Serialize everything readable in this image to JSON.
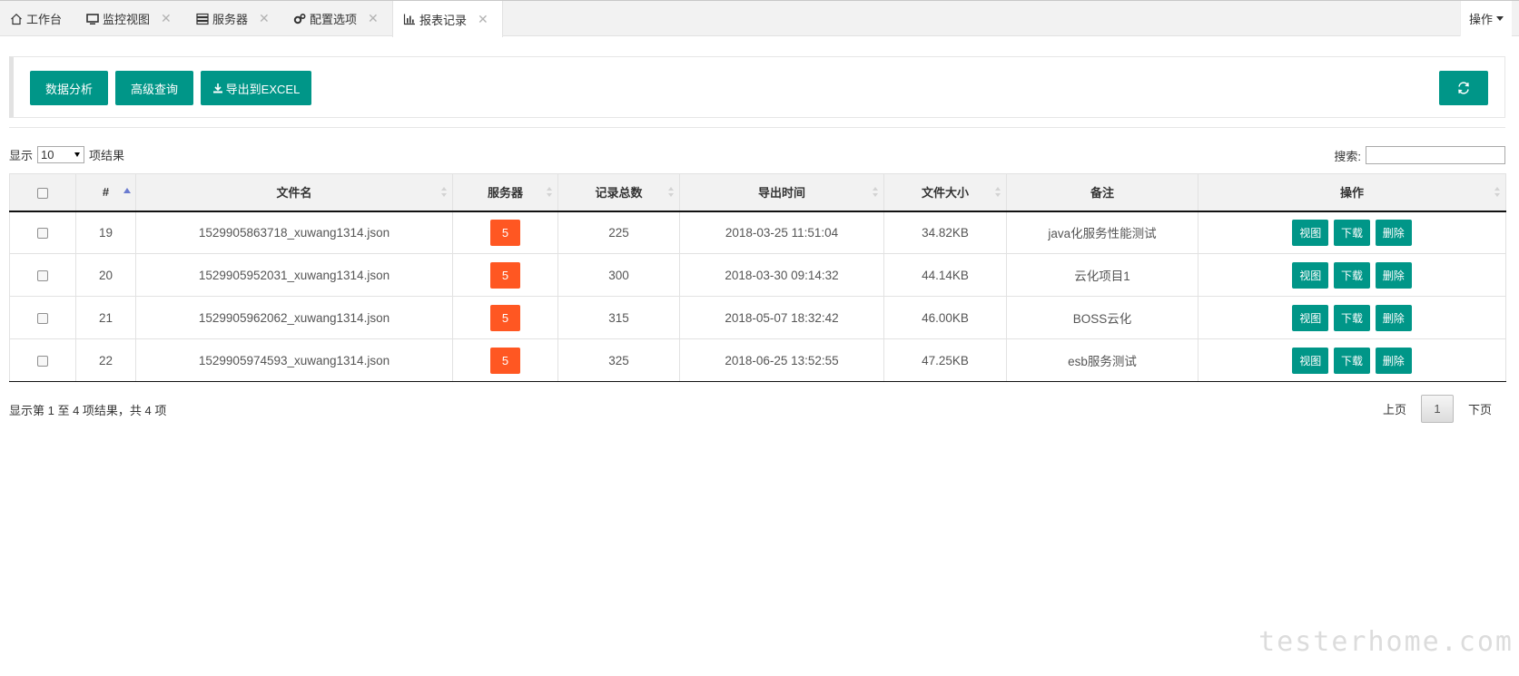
{
  "tabs": [
    {
      "label": "工作台",
      "icon": "home-icon",
      "closable": false,
      "active": false
    },
    {
      "label": "监控视图",
      "icon": "monitor-icon",
      "closable": true,
      "active": false
    },
    {
      "label": "服务器",
      "icon": "server-icon",
      "closable": true,
      "active": false
    },
    {
      "label": "配置选项",
      "icon": "gears-icon",
      "closable": true,
      "active": false
    },
    {
      "label": "报表记录",
      "icon": "bar-chart-icon",
      "closable": true,
      "active": true
    }
  ],
  "tab_close_glyph": "✕",
  "ops_menu_label": "操作",
  "toolbar": {
    "analysis_label": "数据分析",
    "advanced_label": "高级查询",
    "export_label": "导出到EXCEL",
    "refresh_icon": "refresh-icon"
  },
  "length_menu": {
    "prefix": "显示",
    "value": "10",
    "suffix": "项结果"
  },
  "search": {
    "label": "搜索:",
    "value": ""
  },
  "table": {
    "headers": [
      "#",
      "文件名",
      "服务器",
      "记录总数",
      "导出时间",
      "文件大小",
      "备注",
      "操作"
    ],
    "rows": [
      {
        "id": "19",
        "file": "1529905863718_xuwang1314.json",
        "servers": "5",
        "total": "225",
        "time": "2018-03-25 11:51:04",
        "size": "34.82KB",
        "note": "java化服务性能测试"
      },
      {
        "id": "20",
        "file": "1529905952031_xuwang1314.json",
        "servers": "5",
        "total": "300",
        "time": "2018-03-30 09:14:32",
        "size": "44.14KB",
        "note": "云化项目1"
      },
      {
        "id": "21",
        "file": "1529905962062_xuwang1314.json",
        "servers": "5",
        "total": "315",
        "time": "2018-05-07 18:32:42",
        "size": "46.00KB",
        "note": "BOSS云化"
      },
      {
        "id": "22",
        "file": "1529905974593_xuwang1314.json",
        "servers": "5",
        "total": "325",
        "time": "2018-06-25 13:52:55",
        "size": "47.25KB",
        "note": "esb服务测试"
      }
    ],
    "row_actions": {
      "view": "视图",
      "download": "下载",
      "delete": "删除"
    }
  },
  "info_text": "显示第 1 至 4 项结果，共 4 项",
  "pagination": {
    "prev": "上页",
    "current": "1",
    "next": "下页"
  },
  "watermark": "testerhome.com",
  "colors": {
    "primary": "#009688",
    "badge": "#ff5722"
  }
}
